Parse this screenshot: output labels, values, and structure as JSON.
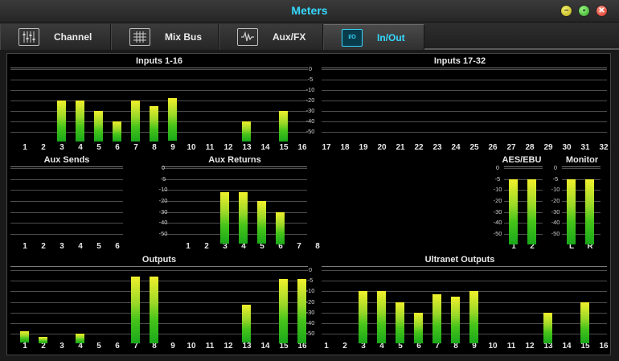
{
  "window": {
    "title": "Meters"
  },
  "tabs": [
    {
      "label": "Channel",
      "icon": "channel-faders-icon",
      "active": false
    },
    {
      "label": "Mix Bus",
      "icon": "mix-bus-grid-icon",
      "active": false
    },
    {
      "label": "Aux/FX",
      "icon": "waveform-icon",
      "active": false
    },
    {
      "label": "In/Out",
      "icon": "io-icon",
      "icon_text": "I/O",
      "active": true
    }
  ],
  "scale": [
    "0",
    "-5",
    "-10",
    "-20",
    "-30",
    "-40",
    "-50"
  ],
  "sections": {
    "inputs_1_16": {
      "title": "Inputs 1-16",
      "channels": [
        "1",
        "2",
        "3",
        "4",
        "5",
        "6",
        "7",
        "8",
        "9",
        "10",
        "11",
        "12",
        "13",
        "14",
        "15",
        "16"
      ],
      "levels_db": [
        null,
        null,
        -20,
        -20,
        -30,
        -40,
        -20,
        -25,
        -18,
        null,
        null,
        null,
        -40,
        null,
        -30,
        null
      ]
    },
    "inputs_17_32": {
      "title": "Inputs 17-32",
      "channels": [
        "17",
        "18",
        "19",
        "20",
        "21",
        "22",
        "23",
        "24",
        "25",
        "26",
        "27",
        "28",
        "29",
        "30",
        "31",
        "32"
      ],
      "levels_db": [
        null,
        null,
        null,
        null,
        null,
        null,
        null,
        null,
        null,
        null,
        null,
        null,
        null,
        null,
        null,
        null
      ]
    },
    "aux_sends": {
      "title": "Aux Sends",
      "channels": [
        "1",
        "2",
        "3",
        "4",
        "5",
        "6"
      ],
      "levels_db": [
        null,
        null,
        null,
        null,
        null,
        null
      ]
    },
    "aux_returns": {
      "title": "Aux Returns",
      "channels": [
        "1",
        "2",
        "3",
        "4",
        "5",
        "6",
        "7",
        "8"
      ],
      "levels_db": [
        null,
        null,
        -12,
        -12,
        -20,
        -30,
        null,
        null
      ]
    },
    "aes_ebu": {
      "title": "AES/EBU",
      "channels": [
        "1",
        "2"
      ],
      "levels_db": [
        -5,
        -5
      ]
    },
    "monitor": {
      "title": "Monitor",
      "channels": [
        "L",
        "R"
      ],
      "levels_db": [
        -5,
        -5
      ]
    },
    "outputs": {
      "title": "Outputs",
      "channels": [
        "1",
        "2",
        "3",
        "4",
        "5",
        "6",
        "7",
        "8",
        "9",
        "10",
        "11",
        "12",
        "13",
        "14",
        "15",
        "16"
      ],
      "levels_db": [
        -48,
        -53,
        null,
        -50,
        null,
        null,
        -3,
        -3,
        null,
        null,
        null,
        null,
        -23,
        null,
        -4,
        -4
      ]
    },
    "ultranet_outputs": {
      "title": "Ultranet Outputs",
      "channels": [
        "1",
        "2",
        "3",
        "4",
        "5",
        "6",
        "7",
        "8",
        "9",
        "10",
        "11",
        "12",
        "13",
        "14",
        "15",
        "16"
      ],
      "levels_db": [
        null,
        null,
        -10,
        -10,
        -20,
        -30,
        -13,
        -15,
        -10,
        null,
        null,
        null,
        -30,
        null,
        -20,
        null
      ]
    }
  }
}
